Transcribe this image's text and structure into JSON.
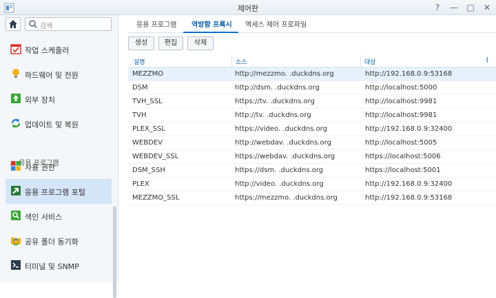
{
  "window": {
    "title": "제어판"
  },
  "title_controls": [
    "?",
    "—",
    "□",
    "✕"
  ],
  "sidebar": {
    "search_placeholder": "검색",
    "items": [
      {
        "label": "작업 스케줄러",
        "icon": "calendar-check-icon"
      },
      {
        "label": "하드웨어 및 전원",
        "icon": "lightbulb-icon"
      },
      {
        "label": "외부 장치",
        "icon": "upload-icon"
      },
      {
        "label": "업데이트 및 복원",
        "icon": "refresh-icon"
      },
      {
        "label": "사용 권한",
        "icon": "grid-icon"
      },
      {
        "label": "응용 프로그램 포털",
        "icon": "portal-arrow-icon"
      },
      {
        "label": "색인 서비스",
        "icon": "magnifier-icon"
      },
      {
        "label": "공유 폴더 동기화",
        "icon": "folder-sync-icon"
      },
      {
        "label": "터미널 및 SNMP",
        "icon": "terminal-icon"
      }
    ],
    "section_label": "응용 프로그램"
  },
  "tabs": [
    {
      "label": "응용 프로그램"
    },
    {
      "label": "역방향 프록시"
    },
    {
      "label": "액세스 제어 프로파일"
    }
  ],
  "toolbar": {
    "create": "생성",
    "edit": "편집",
    "delete": "삭제"
  },
  "table": {
    "headers": [
      "설명",
      "소스",
      "대상"
    ],
    "rows": [
      {
        "desc": "MEZZMO",
        "source": "http://mezzmo.           .duckdns.org",
        "target": "http://192.168.0.9:53168"
      },
      {
        "desc": "DSM",
        "source": "http://dsm.           .duckdns.org",
        "target": "http://localhost:5000"
      },
      {
        "desc": "TVH_SSL",
        "source": "https://tv.           .duckdns.org",
        "target": "http://localhost:9981"
      },
      {
        "desc": "TVH",
        "source": "http://tv.           .duckdns.org",
        "target": "http://localhost:9981"
      },
      {
        "desc": "PLEX_SSL",
        "source": "https://video.           .duckdns.org",
        "target": "http://192.168.0.9:32400"
      },
      {
        "desc": "WEBDEV",
        "source": "http://webdav.           .duckdns.org",
        "target": "http://localhost:5005"
      },
      {
        "desc": "WEBDEV_SSL",
        "source": "https://webdav.           .duckdns.org",
        "target": "https://localhost:5006"
      },
      {
        "desc": "DSM_SSH",
        "source": "https://dsm.           .duckdns.org",
        "target": "https://localhost:5001"
      },
      {
        "desc": "PLEX",
        "source": "http://video.           .duckdns.org",
        "target": "http://192.168.0.9:32400"
      },
      {
        "desc": "MEZZMO_SSL",
        "source": "https://mezzmo.           .duckdns.org",
        "target": "http://192.168.0.9:53168"
      }
    ]
  }
}
